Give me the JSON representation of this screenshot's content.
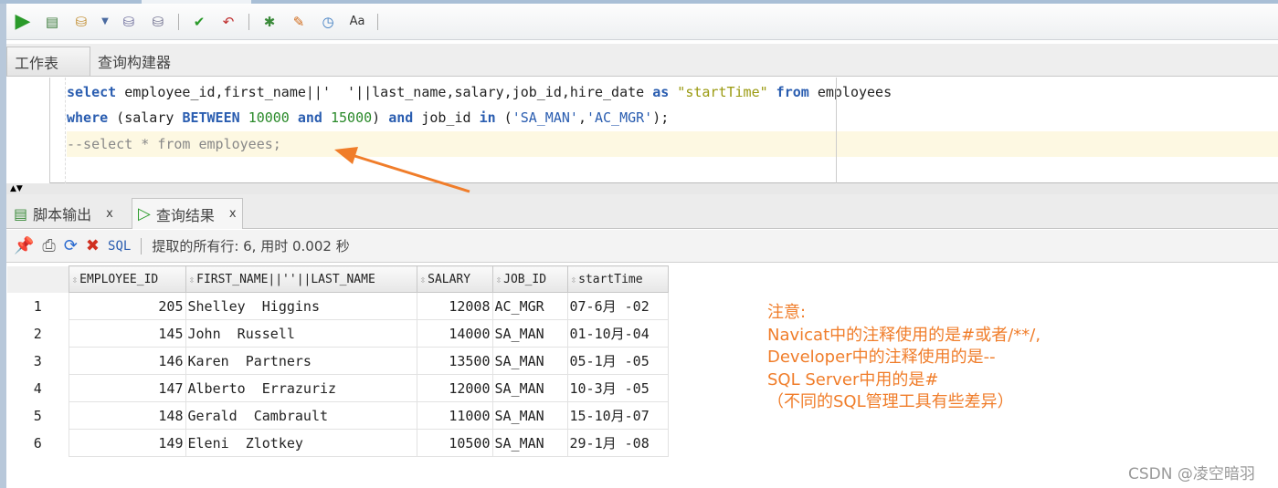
{
  "toolbar": {
    "icons": [
      "run-statement-icon",
      "run-script-icon",
      "autotrace-icon",
      "dropdown-icon",
      "explain-plan-icon",
      "sql-tuning-icon",
      "commit-icon",
      "rollback-icon",
      "sql-worksheet-icon",
      "clear-icon",
      "sql-history-icon",
      "to-upper-lower-icon"
    ]
  },
  "worksheet_tabs": [
    "工作表",
    "查询构建器"
  ],
  "editor": {
    "lines": [
      [
        {
          "t": "select",
          "c": "kw"
        },
        {
          "t": " employee_id,first_name||' ",
          "c": ""
        },
        {
          "t": " '",
          "c": ""
        },
        {
          "t": "||last_name,salary,job_id,hire_date ",
          "c": ""
        },
        {
          "t": "as",
          "c": "kw"
        },
        {
          "t": " ",
          "c": ""
        },
        {
          "t": "\"startTime\"",
          "c": "dstr"
        },
        {
          "t": " ",
          "c": ""
        },
        {
          "t": "from",
          "c": "kw"
        },
        {
          "t": " employees",
          "c": ""
        }
      ],
      [
        {
          "t": "where",
          "c": "kw"
        },
        {
          "t": " (salary ",
          "c": ""
        },
        {
          "t": "BETWEEN",
          "c": "kw"
        },
        {
          "t": " ",
          "c": ""
        },
        {
          "t": "10000",
          "c": "num"
        },
        {
          "t": " ",
          "c": ""
        },
        {
          "t": "and",
          "c": "kw"
        },
        {
          "t": " ",
          "c": ""
        },
        {
          "t": "15000",
          "c": "num"
        },
        {
          "t": ") ",
          "c": ""
        },
        {
          "t": "and",
          "c": "kw"
        },
        {
          "t": " job_id ",
          "c": ""
        },
        {
          "t": "in",
          "c": "kw"
        },
        {
          "t": " (",
          "c": ""
        },
        {
          "t": "'SA_MAN'",
          "c": "str"
        },
        {
          "t": ",",
          "c": ""
        },
        {
          "t": "'AC_MGR'",
          "c": "str"
        },
        {
          "t": ");",
          "c": ""
        }
      ],
      [
        {
          "t": "--select * from employees;",
          "c": "cmt"
        }
      ]
    ]
  },
  "result_tabs": [
    {
      "label": "脚本输出",
      "close": "x"
    },
    {
      "label": "查询结果",
      "close": "x"
    }
  ],
  "result_toolbar": {
    "sql_label": "SQL",
    "status": "提取的所有行: 6, 用时 0.002 秒"
  },
  "table": {
    "columns": [
      "EMPLOYEE_ID",
      "FIRST_NAME||''||LAST_NAME",
      "SALARY",
      "JOB_ID",
      "startTime"
    ],
    "rows": [
      [
        "1",
        "205",
        "Shelley  Higgins",
        "12008",
        "AC_MGR",
        "07-6月 -02"
      ],
      [
        "2",
        "145",
        "John  Russell",
        "14000",
        "SA_MAN",
        "01-10月-04"
      ],
      [
        "3",
        "146",
        "Karen  Partners",
        "13500",
        "SA_MAN",
        "05-1月 -05"
      ],
      [
        "4",
        "147",
        "Alberto  Errazuriz",
        "12000",
        "SA_MAN",
        "10-3月 -05"
      ],
      [
        "5",
        "148",
        "Gerald  Cambrault",
        "11000",
        "SA_MAN",
        "15-10月-07"
      ],
      [
        "6",
        "149",
        "Eleni  Zlotkey",
        "10500",
        "SA_MAN",
        "29-1月 -08"
      ]
    ]
  },
  "annotation": {
    "lines": [
      "注意:",
      "Navicat中的注释使用的是#或者/**/,",
      "Developer中的注释使用的是--",
      "SQL Server中用的是#",
      "（不同的SQL管理工具有些差异）"
    ],
    "color": "#f07d2a"
  },
  "watermark": "CSDN @凌空暗羽"
}
